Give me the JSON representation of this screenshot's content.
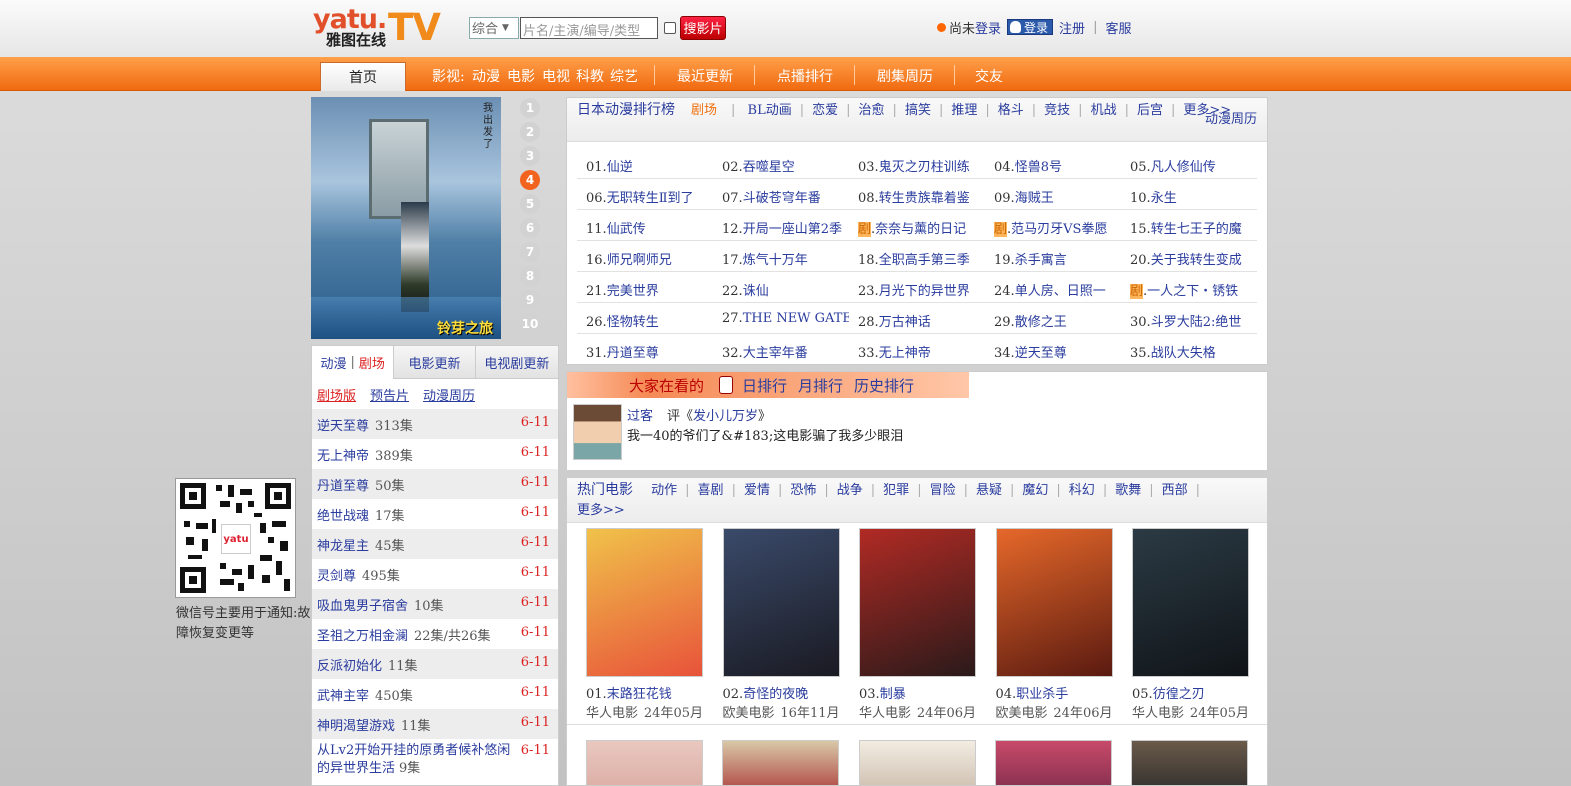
{
  "logo": {
    "yatu": "yatu.",
    "tv": "TV",
    "sub": "雅图在线"
  },
  "search": {
    "select_value": "综合",
    "placeholder": "片名/主演/编导/类型",
    "button": "搜影片"
  },
  "user": {
    "status": "尚未",
    "login": "登录",
    "qq_login": "登录",
    "register": "注册",
    "service": "客服"
  },
  "nav": {
    "home": "首页",
    "genre_prefix": "影视:",
    "genres": [
      "动漫",
      "电影",
      "电视",
      "科教",
      "综艺"
    ],
    "recent": "最近更新",
    "ranking": "点播排行",
    "calendar": "剧集周历",
    "friends": "交友"
  },
  "poster": {
    "title": "铃芽之旅",
    "vertical": "我出发了"
  },
  "rank_numbers": [
    "1",
    "2",
    "3",
    "4",
    "5",
    "6",
    "7",
    "8",
    "9",
    "10"
  ],
  "rank_active": 4,
  "left_tabs": {
    "anime": "动漫",
    "theater": "剧场",
    "movies": "电影更新",
    "tv": "电视剧更新"
  },
  "sublinks": {
    "theater": "剧场版",
    "trailer": "预告片",
    "calendar": "动漫周历"
  },
  "updates": [
    {
      "title": "逆天至尊",
      "eps": "313集",
      "date": "6-11"
    },
    {
      "title": "无上神帝",
      "eps": "389集",
      "date": "6-11"
    },
    {
      "title": "丹道至尊",
      "eps": "50集",
      "date": "6-11"
    },
    {
      "title": "绝世战魂",
      "eps": "17集",
      "date": "6-11"
    },
    {
      "title": "神龙星主",
      "eps": "45集",
      "date": "6-11"
    },
    {
      "title": "灵剑尊",
      "eps": "495集",
      "date": "6-11"
    },
    {
      "title": "吸血鬼男子宿舍",
      "eps": "10集",
      "date": "6-11"
    },
    {
      "title": "圣祖之万相金澜",
      "eps": "22集/共26集",
      "date": "6-11"
    },
    {
      "title": "反派初始化",
      "eps": "11集",
      "date": "6-11"
    },
    {
      "title": "武神主宰",
      "eps": "450集",
      "date": "6-11"
    },
    {
      "title": "神明渴望游戏",
      "eps": "11集",
      "date": "6-11"
    },
    {
      "title": "从Lv2开始开挂的原勇者候补悠闲的异世界生活",
      "eps": "9集",
      "date": "6-11"
    }
  ],
  "qr": {
    "logo": "yatu",
    "text": "微信号主要用于通知:故障恢复变更等"
  },
  "anime_rank": {
    "title": "日本动漫排行榜",
    "active": "剧场",
    "genres": [
      "BL动画",
      "恋爱",
      "治愈",
      "搞笑",
      "推理",
      "格斗",
      "竞技",
      "机战",
      "后宫",
      "更多>>"
    ],
    "calendar": "动漫周历",
    "items": [
      {
        "n": "01.",
        "t": "仙逆"
      },
      {
        "n": "02.",
        "t": "吞噬星空"
      },
      {
        "n": "03.",
        "t": "鬼灭之刃柱训练"
      },
      {
        "n": "04.",
        "t": "怪兽8号"
      },
      {
        "n": "05.",
        "t": "凡人修仙传"
      },
      {
        "n": "06.",
        "t": "无职转生Ⅱ到了"
      },
      {
        "n": "07.",
        "t": "斗破苍穹年番"
      },
      {
        "n": "08.",
        "t": "转生贵族靠着鉴"
      },
      {
        "n": "09.",
        "t": "海贼王"
      },
      {
        "n": "10.",
        "t": "永生"
      },
      {
        "n": "11.",
        "t": "仙武传"
      },
      {
        "n": "12.",
        "t": "开局一座山第2季"
      },
      {
        "n": "剧",
        "t": "奈奈与薰的日记"
      },
      {
        "n": "剧",
        "t": "范马刃牙VS拳愿"
      },
      {
        "n": "15.",
        "t": "转生七王子的魔"
      },
      {
        "n": "16.",
        "t": "师兄啊师兄"
      },
      {
        "n": "17.",
        "t": "炼气十万年"
      },
      {
        "n": "18.",
        "t": "全职高手第三季"
      },
      {
        "n": "19.",
        "t": "杀手寓言"
      },
      {
        "n": "20.",
        "t": "关于我转生变成"
      },
      {
        "n": "21.",
        "t": "完美世界"
      },
      {
        "n": "22.",
        "t": "诛仙"
      },
      {
        "n": "23.",
        "t": "月光下的异世界"
      },
      {
        "n": "24.",
        "t": "单人房、日照一"
      },
      {
        "n": "剧",
        "t": "一人之下・锈铁"
      },
      {
        "n": "26.",
        "t": "怪物转生"
      },
      {
        "n": "27.",
        "t": "THE NEW GATE"
      },
      {
        "n": "28.",
        "t": "万古神话"
      },
      {
        "n": "29.",
        "t": "散修之王"
      },
      {
        "n": "30.",
        "t": "斗罗大陆2:绝世"
      },
      {
        "n": "31.",
        "t": "丹道至尊"
      },
      {
        "n": "32.",
        "t": "大主宰年番"
      },
      {
        "n": "33.",
        "t": "无上神帝"
      },
      {
        "n": "34.",
        "t": "逆天至尊"
      },
      {
        "n": "35.",
        "t": "战队大失格"
      }
    ]
  },
  "watching": {
    "title": "大家在看的",
    "daily": "日排行",
    "monthly": "月排行",
    "history": "历史排行",
    "user": "过客",
    "evaluate": "评《",
    "movie": "发小儿万岁",
    "close": "》",
    "message": "我一40的爷们了&#183;这电影骗了我多少眼泪"
  },
  "hot_movies": {
    "title": "热门电影",
    "genres": [
      "动作",
      "喜剧",
      "爱情",
      "恐怖",
      "战争",
      "犯罪",
      "冒险",
      "悬疑",
      "魔幻",
      "科幻",
      "歌舞",
      "西部"
    ],
    "more": "更多>>",
    "items": [
      {
        "n": "01.",
        "t": "末路狂花钱",
        "region": "华人电影",
        "date": "24年05月",
        "c1": "#f0c24a",
        "c2": "#e8533a"
      },
      {
        "n": "02.",
        "t": "奇怪的夜晚",
        "region": "欧美电影",
        "date": "16年11月",
        "c1": "#3a4a6a",
        "c2": "#1a1a22"
      },
      {
        "n": "03.",
        "t": "制暴",
        "region": "华人电影",
        "date": "24年06月",
        "c1": "#b12a24",
        "c2": "#2a1a1a"
      },
      {
        "n": "04.",
        "t": "职业杀手",
        "region": "欧美电影",
        "date": "24年06月",
        "c1": "#e6682a",
        "c2": "#5a1a10"
      },
      {
        "n": "05.",
        "t": "彷徨之刃",
        "region": "华人电影",
        "date": "24年05月",
        "c1": "#2b3a44",
        "c2": "#101418"
      }
    ]
  }
}
